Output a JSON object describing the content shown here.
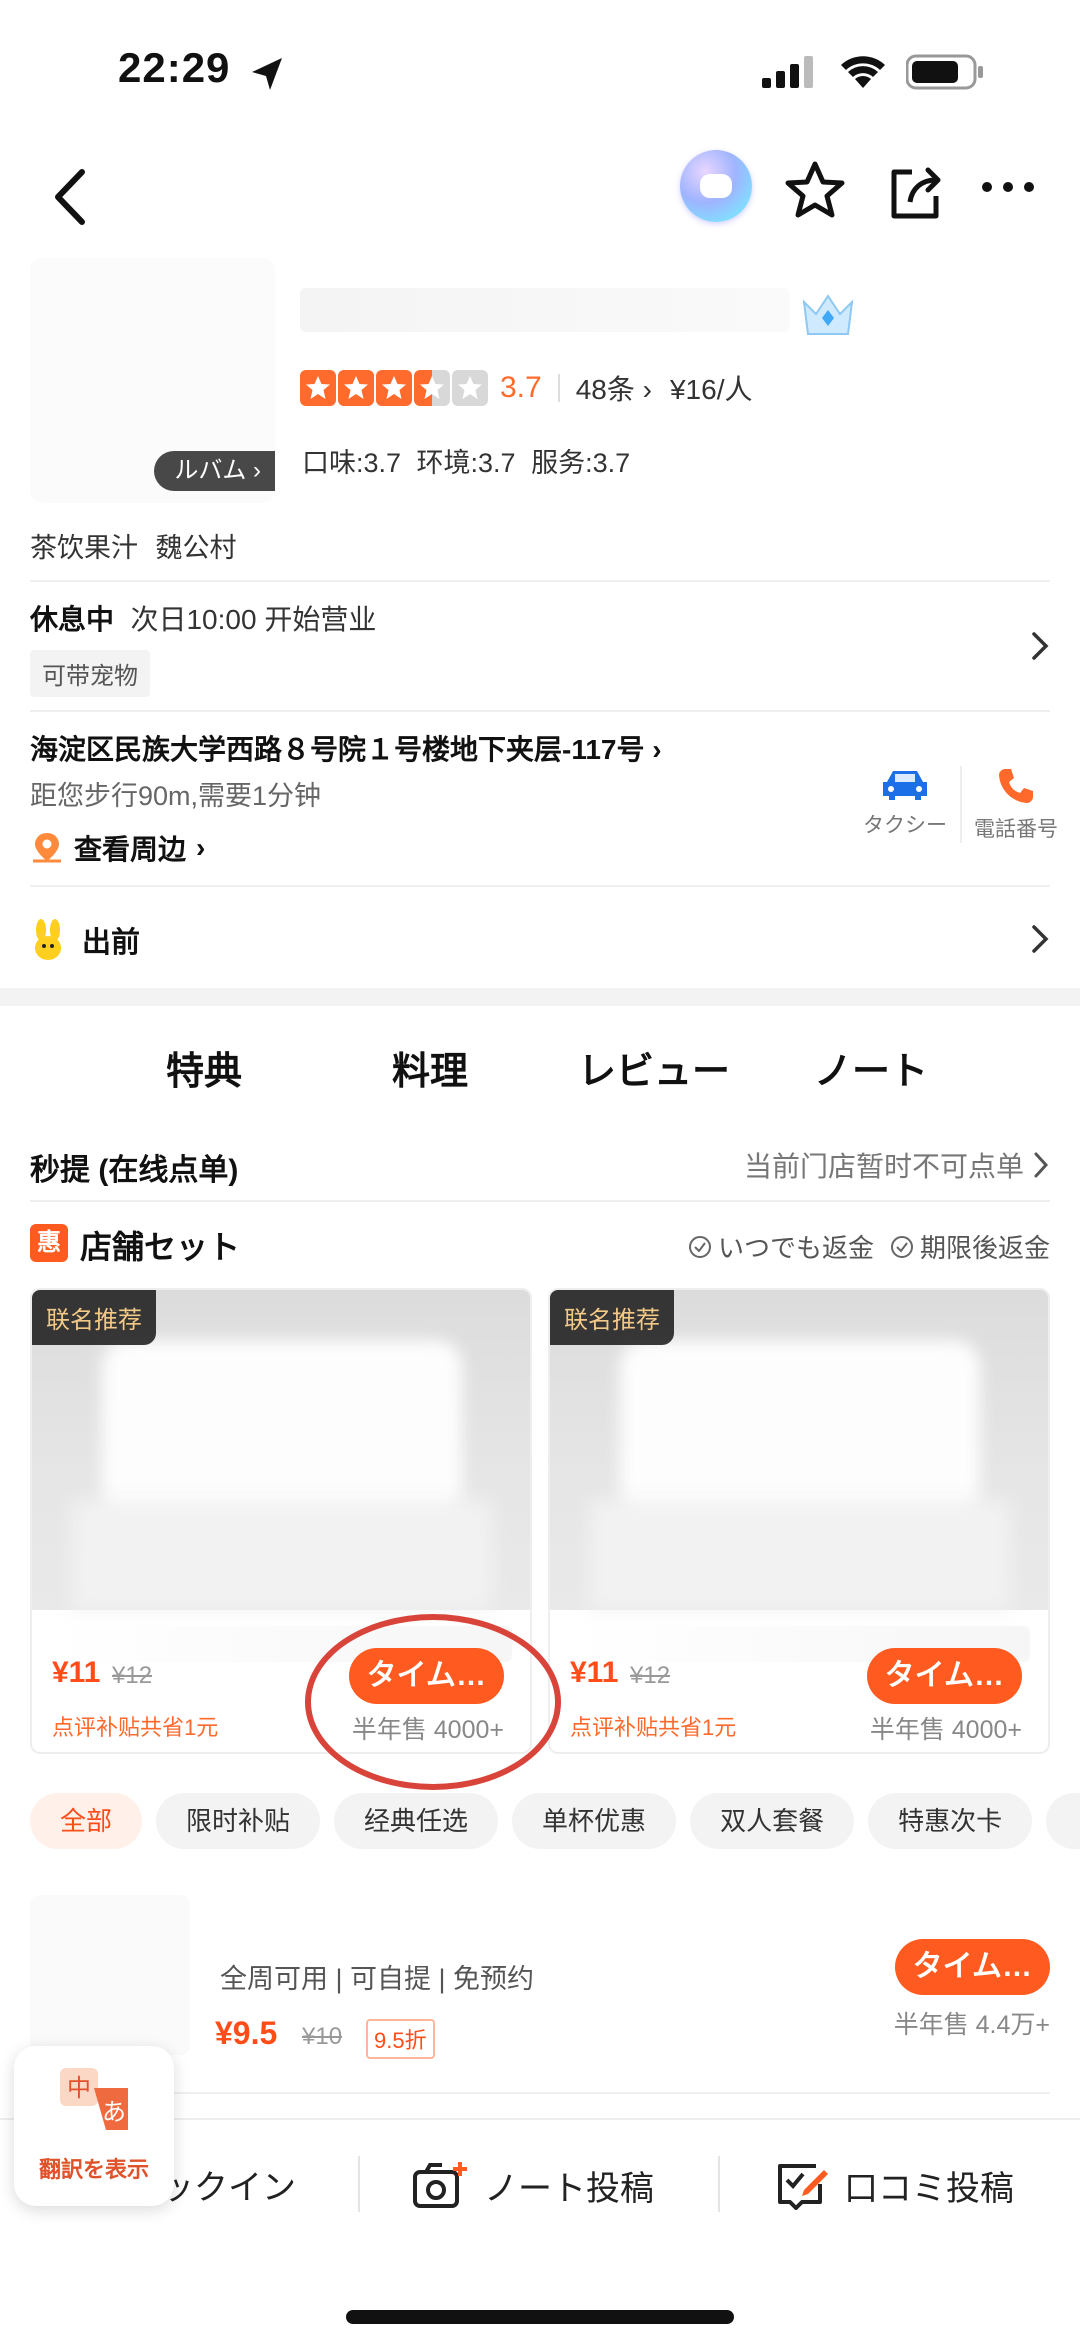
{
  "status_bar": {
    "time": "22:29"
  },
  "shop": {
    "thumb_tag": "ルバム",
    "rating_score": "3.7",
    "stars": [
      "full",
      "full",
      "full",
      "half",
      "empty"
    ],
    "review_count": "48条",
    "price_per_person": "¥16/人",
    "sub_scores": "口味:3.7 环境:3.7 服务:3.7",
    "category": "茶饮果汁 魏公村"
  },
  "hours": {
    "status": "休息中",
    "next_open": "次日10:00 开始营业",
    "pet_tag": "可带宠物"
  },
  "address": {
    "text": "海淀区民族大学西路８号院１号楼地下夹层-117号",
    "distance": "距您步行90m,需要1分钟",
    "nearby": "查看周边",
    "taxi_label": "タクシー",
    "phone_label": "電話番号"
  },
  "delivery": {
    "label": "出前"
  },
  "tabs": [
    "特典",
    "料理",
    "レビュー",
    "ノート"
  ],
  "quick_order": {
    "title": "秒提 (在线点单)",
    "note": "当前门店暂时不可点单"
  },
  "sets": {
    "badge": "惠",
    "title": "店舗セット",
    "refund_anytime": "いつでも返金",
    "refund_expired": "期限後返金"
  },
  "deals": [
    {
      "tag": "联名推荐",
      "price": "¥11",
      "orig": "¥12",
      "subsidy": "点评补贴共省1元",
      "timer": "タイム…",
      "sold": "半年售 4000+"
    },
    {
      "tag": "联名推荐",
      "price": "¥11",
      "orig": "¥12",
      "subsidy": "点评补贴共省1元",
      "timer": "タイム…",
      "sold": "半年售 4000+"
    }
  ],
  "filters": [
    "全部",
    "限时补贴",
    "经典任选",
    "单杯优惠",
    "双人套餐",
    "特惠次卡"
  ],
  "list_item": {
    "features": "全周可用 | 可自提 | 免预约",
    "price": "¥9.5",
    "orig": "¥10",
    "discount": "9.5折",
    "timer": "タイム…",
    "sold": "半年售 4.4万+"
  },
  "bottom_bar": {
    "checkin": "ックイン",
    "note_post": "ノート投稿",
    "review_post": "口コミ投稿"
  },
  "translate": {
    "label": "翻訳を表示",
    "glyph_a": "中",
    "glyph_b": "あ"
  },
  "colors": {
    "accent": "#ff5a1f",
    "ring": "#d8443a",
    "taxi": "#1c6fe6"
  }
}
